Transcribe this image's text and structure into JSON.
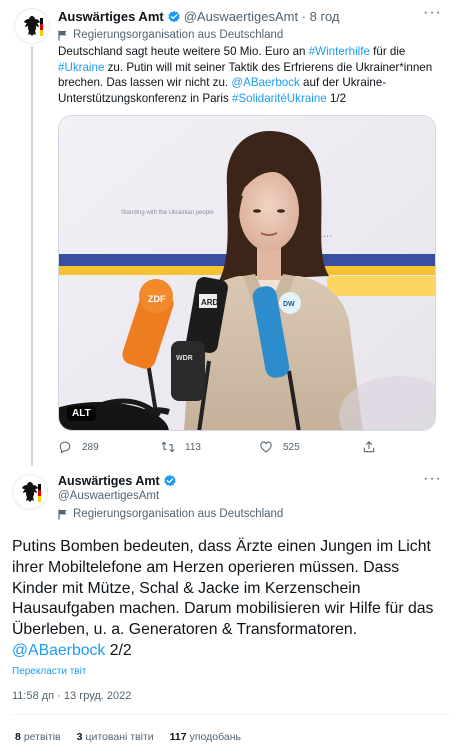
{
  "colors": {
    "accent": "#1d9bf0",
    "muted": "#536471",
    "verified": "#1d9bf0"
  },
  "tweet1": {
    "name": "Auswärtiges Amt",
    "handle": "@AuswaertigesAmt",
    "time": "8 год",
    "gov_label": "Regierungsorganisation aus Deutschland",
    "text_parts": [
      {
        "t": "Deutschland sagt heute weitere 50 Mio. Euro an ",
        "link": false
      },
      {
        "t": "#Winterhilfe",
        "link": true
      },
      {
        "t": " für die ",
        "link": false
      },
      {
        "t": "#Ukraine",
        "link": true
      },
      {
        "t": " zu. Putin will mit seiner Taktik des Erfrierens die Ukrainer*innen brechen. Das lassen wir nicht zu. ",
        "link": false
      },
      {
        "t": "@ABaerbock",
        "link": true
      },
      {
        "t": " auf der Ukraine-Unterstützungskonferenz in Paris ",
        "link": false
      },
      {
        "t": "#SolidaritéUkraine",
        "link": true
      },
      {
        "t": " 1/2",
        "link": false
      }
    ],
    "media": {
      "alt_badge": "ALT",
      "banner_text": "Standing with the Ukrainian people",
      "mic_labels": [
        "ZDF",
        "ARD",
        "WDR",
        "DW"
      ]
    },
    "actions": {
      "replies": "289",
      "retweets": "113",
      "likes": "525"
    }
  },
  "tweet2": {
    "name": "Auswärtiges Amt",
    "handle": "@AuswaertigesAmt",
    "gov_label": "Regierungsorganisation aus Deutschland",
    "text_main": "Putins Bomben bedeuten, dass Ärzte einen Jungen im Licht ihrer Mobiltelefone am Herzen operieren müssen. Dass Kinder mit Mütze, Schal & Jacke im Kerzenschein Hausaufgaben machen. Darum mobilisieren wir Hilfe für das Überleben, u. a. Generatoren & Transformatoren. ",
    "text_mention": "@ABaerbock",
    "text_suffix": " 2/2",
    "translate": "Перекласти твіт",
    "timestamp": "11:58 дп · 13 груд. 2022",
    "stats": {
      "retweets_count": "8",
      "retweets_label": "ретвітів",
      "quotes_count": "3",
      "quotes_label": "цитовані твіти",
      "likes_count": "117",
      "likes_label": "уподобань"
    }
  }
}
